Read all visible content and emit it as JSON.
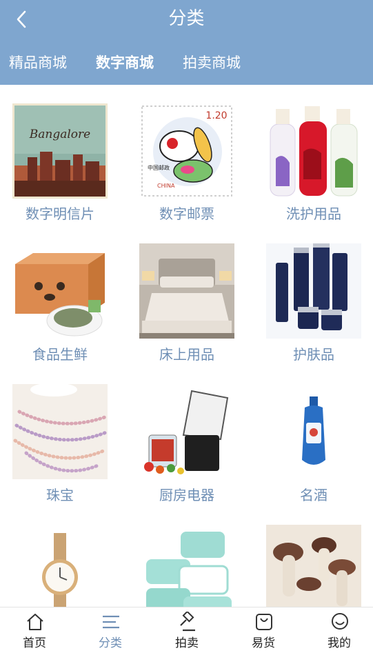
{
  "header": {
    "title": "分类",
    "tabs": [
      {
        "label": "精品商城"
      },
      {
        "label": "数字商城"
      },
      {
        "label": "拍卖商城"
      }
    ],
    "active_tab": "数字商城"
  },
  "categories": [
    {
      "label": "数字明信片",
      "image": "postcard-bangalore"
    },
    {
      "label": "数字邮票",
      "image": "rabbit-stamp"
    },
    {
      "label": "洗护用品",
      "image": "shampoo-bottles"
    },
    {
      "label": "食品生鲜",
      "image": "food-box"
    },
    {
      "label": "床上用品",
      "image": "bedroom"
    },
    {
      "label": "护肤品",
      "image": "skincare-set"
    },
    {
      "label": "珠宝",
      "image": "pearl-necklaces"
    },
    {
      "label": "厨房电器",
      "image": "blender"
    },
    {
      "label": "名酒",
      "image": "liquor-bottle"
    },
    {
      "label": "",
      "image": "wristwatch"
    },
    {
      "label": "",
      "image": "wet-wipes"
    },
    {
      "label": "",
      "image": "mushrooms"
    }
  ],
  "stamp": {
    "price": "1.20",
    "country_cn": "中国邮政",
    "country_en": "CHINA"
  },
  "postcard": {
    "text": "Bangalore"
  },
  "nav": [
    {
      "label": "首页",
      "icon": "home-icon"
    },
    {
      "label": "分类",
      "icon": "category-icon"
    },
    {
      "label": "拍卖",
      "icon": "auction-icon"
    },
    {
      "label": "易货",
      "icon": "barter-bag-icon"
    },
    {
      "label": "我的",
      "icon": "profile-icon"
    }
  ],
  "colors": {
    "header": "#7fa6cf",
    "accent": "#6f8fb5",
    "background": "#ffffff"
  }
}
